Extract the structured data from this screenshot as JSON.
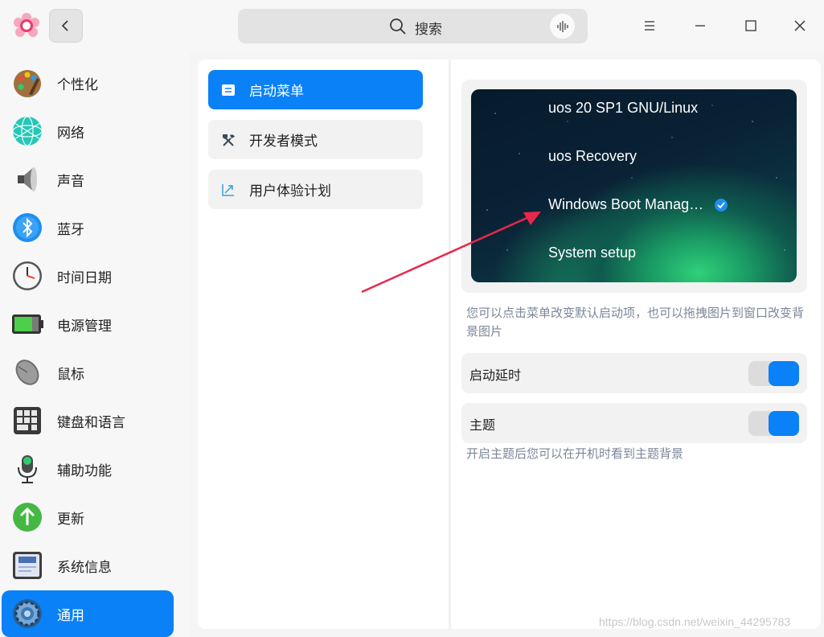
{
  "titlebar": {
    "search_placeholder": "搜索",
    "icons": [
      "app-logo-icon",
      "back-icon",
      "search-icon",
      "voice-icon",
      "menu-icon",
      "minimize-icon",
      "maximize-icon",
      "close-icon"
    ]
  },
  "sidebar": {
    "items": [
      {
        "label": "个性化",
        "icon": "personalization-icon"
      },
      {
        "label": "网络",
        "icon": "network-icon"
      },
      {
        "label": "声音",
        "icon": "sound-icon"
      },
      {
        "label": "蓝牙",
        "icon": "bluetooth-icon"
      },
      {
        "label": "时间日期",
        "icon": "clock-icon"
      },
      {
        "label": "电源管理",
        "icon": "battery-icon"
      },
      {
        "label": "鼠标",
        "icon": "mouse-icon"
      },
      {
        "label": "键盘和语言",
        "icon": "keyboard-icon"
      },
      {
        "label": "辅助功能",
        "icon": "microphone-icon"
      },
      {
        "label": "更新",
        "icon": "update-icon"
      },
      {
        "label": "系统信息",
        "icon": "system-info-icon"
      },
      {
        "label": "通用",
        "icon": "general-gear-icon"
      }
    ],
    "active_index": 11
  },
  "submenu": {
    "items": [
      {
        "label": "启动菜单",
        "icon": "boot-menu-icon"
      },
      {
        "label": "开发者模式",
        "icon": "developer-tools-icon"
      },
      {
        "label": "用户体验计划",
        "icon": "user-experience-icon"
      }
    ],
    "active_index": 0
  },
  "boot": {
    "entries": [
      "uos 20 SP1 GNU/Linux",
      "uos Recovery",
      "Windows Boot Manag…",
      "System setup"
    ],
    "selected_index": 2,
    "hint": "您可以点击菜单改变默认启动项，也可以拖拽图片到窗口改变背景图片"
  },
  "settings": {
    "startup_delay": {
      "label": "启动延时",
      "on": true
    },
    "theme": {
      "label": "主题",
      "on": true
    },
    "theme_hint": "开启主题后您可以在开机时看到主题背景"
  },
  "watermark": "https://blog.csdn.net/weixin_44295783",
  "colors": {
    "accent": "#0a81f6",
    "annotation_arrow": "#e8274a",
    "hint_text": "#7b8799"
  }
}
